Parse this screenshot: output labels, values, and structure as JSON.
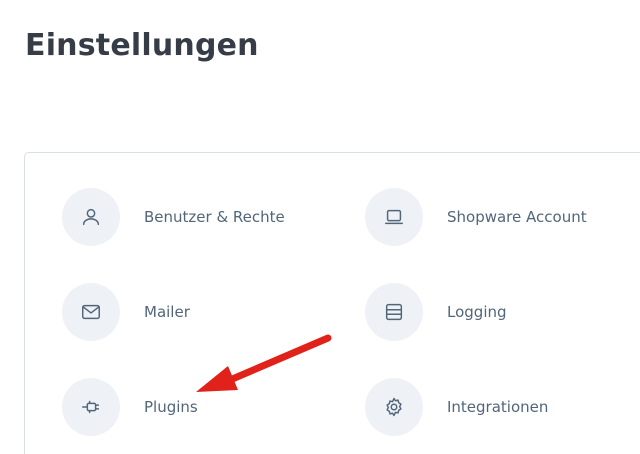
{
  "page": {
    "title": "Einstellungen"
  },
  "settings": {
    "items": [
      {
        "label": "Benutzer & Rechte",
        "icon": "user-icon"
      },
      {
        "label": "Shopware Account",
        "icon": "laptop-icon"
      },
      {
        "label": "Mailer",
        "icon": "envelope-icon"
      },
      {
        "label": "Logging",
        "icon": "database-icon"
      },
      {
        "label": "Plugins",
        "icon": "plug-icon"
      },
      {
        "label": "Integrationen",
        "icon": "gear-icon"
      }
    ]
  },
  "colors": {
    "title": "#363d47",
    "label": "#52667a",
    "icon_bg": "#eef1f6",
    "icon_stroke": "#52667a",
    "arrow": "#e0221b"
  }
}
